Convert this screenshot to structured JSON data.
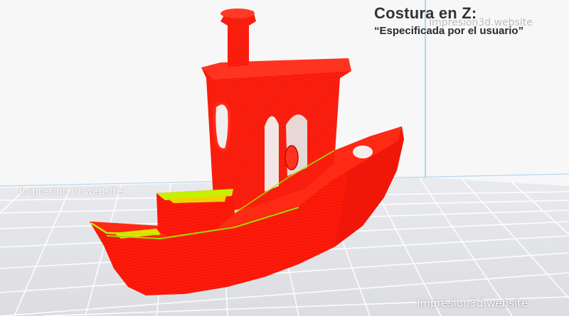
{
  "overlay": {
    "title": "Costura en Z:",
    "subtitle": "“Especificada por el usuario”"
  },
  "watermarks": {
    "top": "Impresion3d.website",
    "left": "Impresion3d.website",
    "bottom": "Impresion3d.website"
  },
  "colors": {
    "model": "#ff1a0a",
    "seam_highlight": "#c6f000",
    "build_plate": "#e6e7ea",
    "grid_line": "#ffffff",
    "wall_line": "#9cc9e8"
  },
  "icons": {
    "model": "benchy-boat-3d-model",
    "build_plate": "build-plate-grid"
  }
}
